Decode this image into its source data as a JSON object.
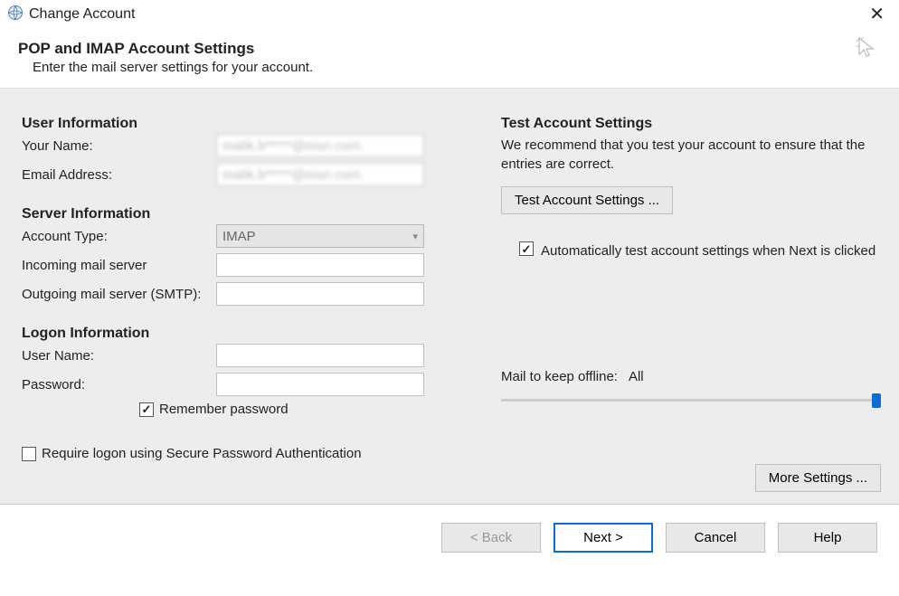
{
  "titlebar": {
    "title": "Change Account"
  },
  "header": {
    "title": "POP and IMAP Account Settings",
    "subtitle": "Enter the mail server settings for your account."
  },
  "left": {
    "userInfo": {
      "heading": "User Information",
      "yourNameLabel": "Your Name:",
      "yourNameValue": "malik.b*****@msn.com",
      "emailLabel": "Email Address:",
      "emailValue": "malik.b*****@msn.com"
    },
    "serverInfo": {
      "heading": "Server Information",
      "accountTypeLabel": "Account Type:",
      "accountTypeValue": "IMAP",
      "incomingLabel": "Incoming mail server",
      "incomingValue": "",
      "outgoingLabel": "Outgoing mail server (SMTP):",
      "outgoingValue": ""
    },
    "logonInfo": {
      "heading": "Logon Information",
      "userNameLabel": "User Name:",
      "userNameValue": "",
      "passwordLabel": "Password:",
      "passwordValue": "",
      "rememberLabel": "Remember password",
      "rememberChecked": true,
      "spaLabel": "Require logon using Secure Password Authentication",
      "spaChecked": false
    }
  },
  "right": {
    "testHeading": "Test Account Settings",
    "testDesc": "We recommend that you test your account to ensure that the entries are correct.",
    "testButton": "Test Account Settings ...",
    "autoTestLabel": "Automatically test account settings when Next is clicked",
    "autoTestChecked": true,
    "offlineLabel": "Mail to keep offline:",
    "offlineValue": "All",
    "moreSettingsButton": "More Settings ..."
  },
  "footer": {
    "back": "< Back",
    "next": "Next >",
    "cancel": "Cancel",
    "help": "Help"
  }
}
